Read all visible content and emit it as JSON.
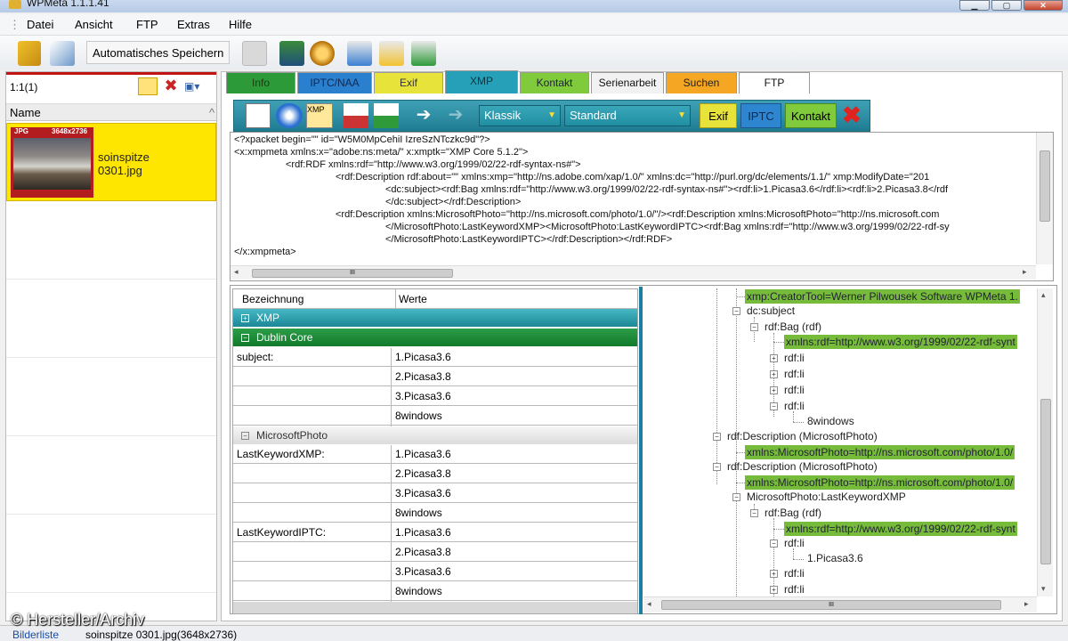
{
  "window": {
    "title": "WPMeta 1.1.1.41"
  },
  "menu": [
    "Datei",
    "Ansicht",
    "FTP",
    "Extras",
    "Hilfe"
  ],
  "toolbar": {
    "autosave_label": "Automatisches Speichern"
  },
  "left": {
    "count": "1:1(1)",
    "column_header": "Name",
    "file": {
      "name_line1": "soinspitze",
      "name_line2": "0301.jpg",
      "type_tag": "JPG",
      "size_tag": "3648x2736"
    }
  },
  "tabs": [
    "Info",
    "IPTC/NAA",
    "Exif",
    "XMP",
    "Kontakt",
    "Serienarbeit",
    "Suchen",
    "FTP"
  ],
  "tab_colors": [
    "#2d9a3a",
    "#2a7fcf",
    "#e8e33a",
    "#25a0b8",
    "#7fcb3c",
    "#f2f2f2",
    "#f5a623",
    "#ffffff"
  ],
  "xmp_toolbar": {
    "combo1": "Klassik",
    "combo2": "Standard",
    "btn_exif": "Exif",
    "btn_iptc": "IPTC",
    "btn_kontakt": "Kontakt",
    "xmp_icon_label": "XMP"
  },
  "xml_lines": [
    "<?xpacket begin=\"\" id=\"W5M0MpCehiI IzreSzNTczkc9d\"?>",
    "<x:xmpmeta xmlns:x=\"adobe:ns:meta/\" x:xmptk=\"XMP Core 5.1.2\">",
    "<rdf:RDF xmlns:rdf=\"http://www.w3.org/1999/02/22-rdf-syntax-ns#\">",
    "<rdf:Description rdf:about=\"\" xmlns:xmp=\"http://ns.adobe.com/xap/1.0/\" xmlns:dc=\"http://purl.org/dc/elements/1.1/\" xmp:ModifyDate=\"201",
    "<dc:subject><rdf:Bag xmlns:rdf=\"http://www.w3.org/1999/02/22-rdf-syntax-ns#\"><rdf:li>1.Picasa3.6</rdf:li><rdf:li>2.Picasa3.8</rdf",
    "</dc:subject></rdf:Description>",
    "<rdf:Description xmlns:MicrosoftPhoto=\"http://ns.microsoft.com/photo/1.0/\"/><rdf:Description xmlns:MicrosoftPhoto=\"http://ns.microsoft.com",
    "</MicrosoftPhoto:LastKeywordXMP><MicrosoftPhoto:LastKeywordIPTC><rdf:Bag xmlns:rdf=\"http://www.w3.org/1999/02/22-rdf-sy",
    "</MicrosoftPhoto:LastKeywordIPTC></rdf:Description></rdf:RDF>",
    "</x:xmpmeta>"
  ],
  "props": {
    "col_name": "Bezeichnung",
    "col_value": "Werte",
    "group_xmp": "XMP",
    "group_dc": "Dublin Core",
    "group_ms": "MicrosoftPhoto",
    "rows": [
      {
        "name": "subject:",
        "value": "1.Picasa3.6"
      },
      {
        "name": "",
        "value": "2.Picasa3.8"
      },
      {
        "name": "",
        "value": "3.Picasa3.6"
      },
      {
        "name": "",
        "value": "8windows"
      }
    ],
    "ms_rows": [
      {
        "name": "LastKeywordXMP:",
        "value": "1.Picasa3.6"
      },
      {
        "name": "",
        "value": "2.Picasa3.8"
      },
      {
        "name": "",
        "value": "3.Picasa3.6"
      },
      {
        "name": "",
        "value": "8windows"
      },
      {
        "name": "LastKeywordIPTC:",
        "value": "1.Picasa3.6"
      },
      {
        "name": "",
        "value": "2.Picasa3.8"
      },
      {
        "name": "",
        "value": "3.Picasa3.6"
      },
      {
        "name": "",
        "value": "8windows"
      }
    ]
  },
  "tree": {
    "creator": "xmp:CreatorTool=Werner Pilwousek Software WPMeta 1.",
    "dc_subject": "dc:subject",
    "bag": "rdf:Bag (rdf)",
    "bag_ns": "xmlns:rdf=http://www.w3.org/1999/02/22-rdf-synt",
    "li": "rdf:li",
    "win": "8windows",
    "desc_ms": "rdf:Description (MicrosoftPhoto)",
    "ms_ns": "xmlns:MicrosoftPhoto=http://ns.microsoft.com/photo/1.0/",
    "last_xmp": "MicrosoftPhoto:LastKeywordXMP",
    "val1": "1.Picasa3.6"
  },
  "scroll_glyph": "III",
  "status": {
    "list": "Bilderliste",
    "file": "soinspitze 0301.jpg(3648x2736)"
  },
  "watermark": "© Hersteller/Archiv"
}
